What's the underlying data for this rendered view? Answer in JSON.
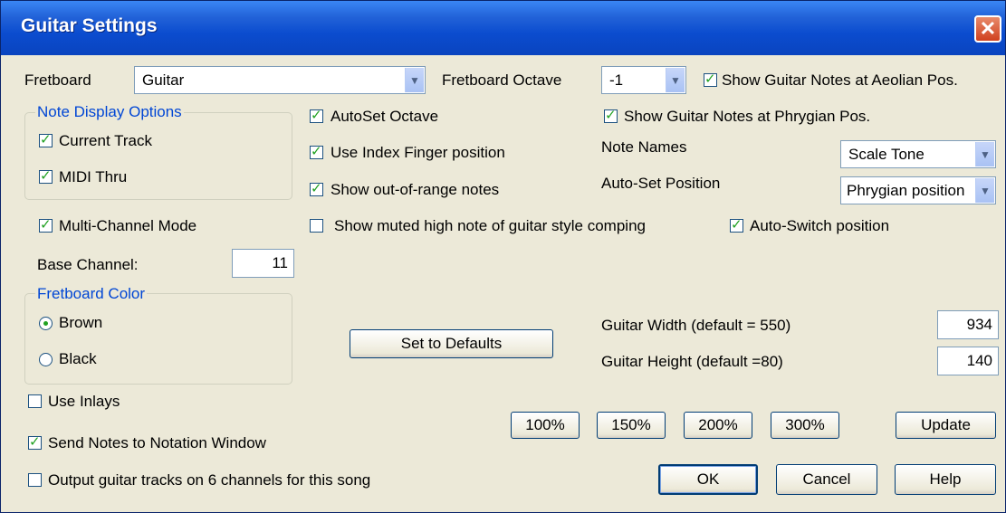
{
  "window": {
    "title": "Guitar Settings",
    "close_symbol": "✕"
  },
  "fretboard": {
    "label": "Fretboard",
    "value": "Guitar",
    "octave_label": "Fretboard Octave",
    "octave_value": "-1"
  },
  "checks": {
    "aeolian": "Show Guitar Notes at Aeolian Pos.",
    "phrygian": "Show Guitar Notes at Phrygian Pos.",
    "autoset_octave": "AutoSet Octave",
    "index_finger": "Use Index Finger position",
    "out_of_range": "Show out-of-range notes",
    "muted_high": "Show muted high note of guitar style comping",
    "auto_switch": "Auto-Switch position",
    "multi_channel": "Multi-Channel Mode",
    "use_inlays": "Use Inlays",
    "send_notes": "Send Notes to Notation Window",
    "output_6ch": "Output guitar tracks on 6 channels for this song"
  },
  "note_display": {
    "legend": "Note Display Options",
    "current_track": "Current Track",
    "midi_thru": "MIDI Thru"
  },
  "note_names": {
    "label": "Note Names",
    "value": "Scale Tone"
  },
  "auto_set_position": {
    "label": "Auto-Set Position",
    "value": "Phrygian position"
  },
  "base_channel": {
    "label": "Base Channel:",
    "value": "11"
  },
  "fretboard_color": {
    "legend": "Fretboard Color",
    "brown": "Brown",
    "black": "Black"
  },
  "guitar_width": {
    "label": "Guitar Width  (default = 550)",
    "value": "934"
  },
  "guitar_height": {
    "label": "Guitar Height (default =80)",
    "value": "140"
  },
  "buttons": {
    "set_defaults": "Set to Defaults",
    "p100": "100%",
    "p150": "150%",
    "p200": "200%",
    "p300": "300%",
    "update": "Update",
    "ok": "OK",
    "cancel": "Cancel",
    "help": "Help"
  }
}
